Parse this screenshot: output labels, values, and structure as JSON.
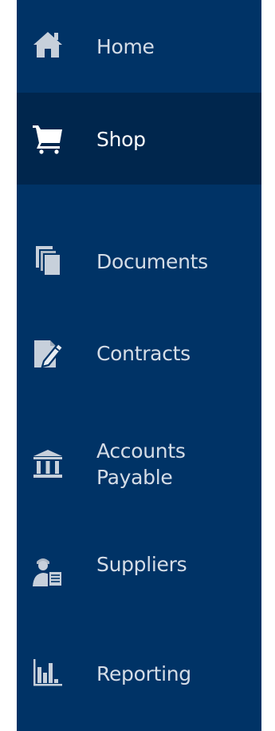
{
  "sidebar": {
    "accent_color": "#003366",
    "active_color": "#00264d",
    "items": [
      {
        "label": "Home",
        "icon": "home-icon",
        "active": false
      },
      {
        "label": "Shop",
        "icon": "shopping-cart-icon",
        "active": true
      },
      {
        "label": "Documents",
        "icon": "documents-icon",
        "active": false
      },
      {
        "label": "Contracts",
        "icon": "contract-pen-icon",
        "active": false
      },
      {
        "label": "Accounts Payable",
        "icon": "bank-icon",
        "active": false
      },
      {
        "label": "Suppliers",
        "icon": "supplier-person-icon",
        "active": false
      },
      {
        "label": "Reporting",
        "icon": "bar-chart-icon",
        "active": false
      }
    ]
  }
}
